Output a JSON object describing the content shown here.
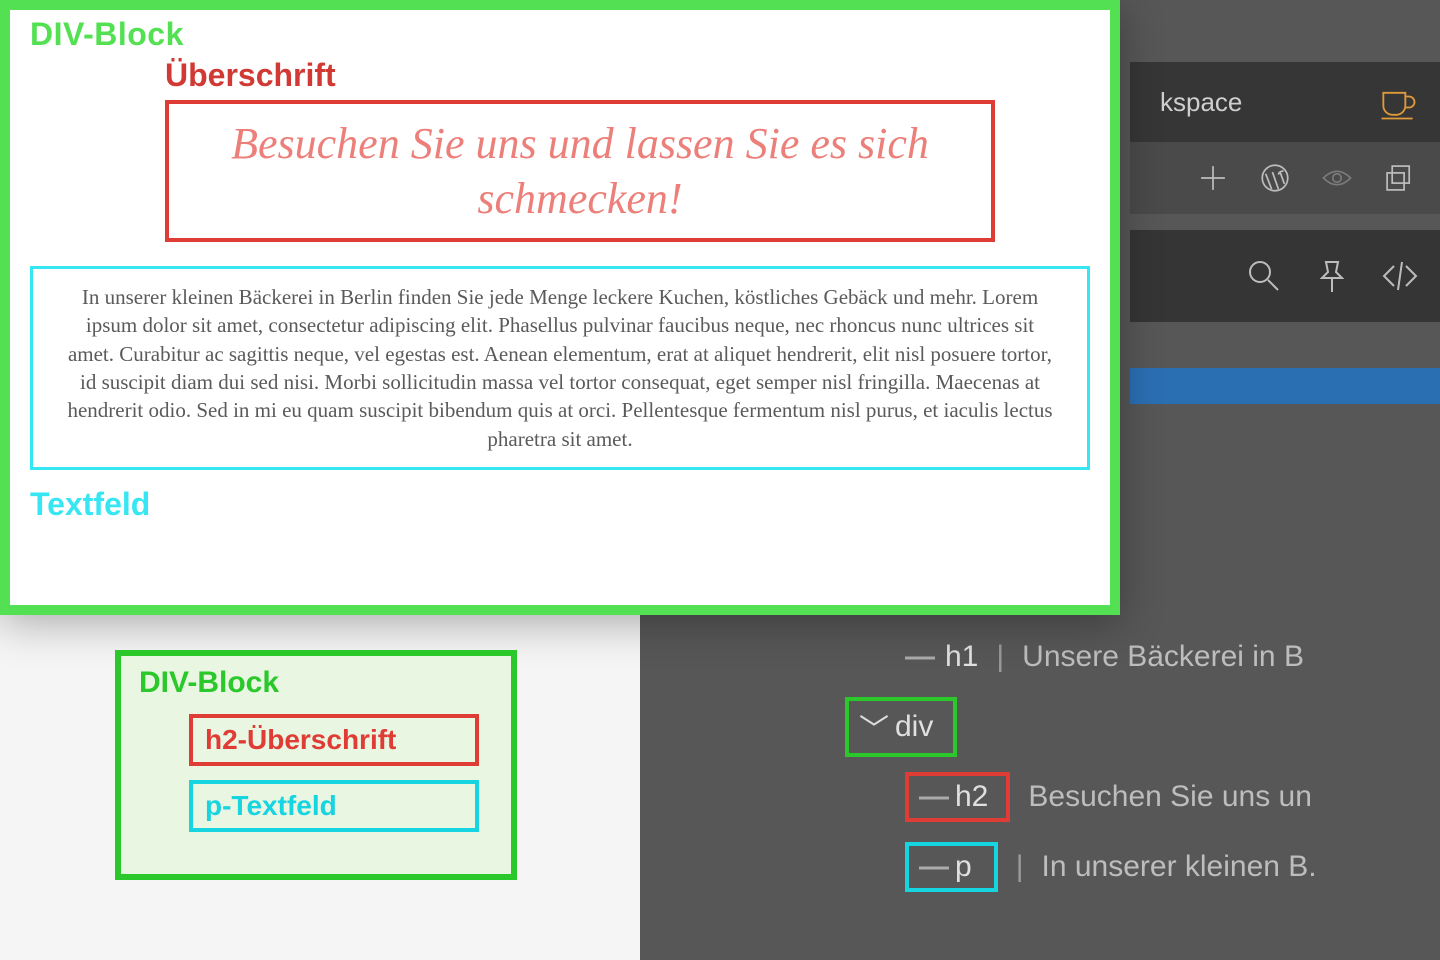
{
  "preview": {
    "label_div": "DIV-Block",
    "label_heading": "Überschrift",
    "h2_text": "Besuchen Sie uns und lassen Sie es sich schmecken!",
    "p_text": "In unserer kleinen Bäckerei in Berlin finden Sie jede Menge leckere Kuchen, köstliches Gebäck und mehr. Lorem ipsum dolor sit amet, consectetur adipiscing elit. Phasellus pulvinar faucibus neque, nec rhoncus nunc ultrices sit amet. Curabitur ac sagittis neque, vel egestas est. Aenean elementum, erat at aliquet hendrerit, elit nisl posuere tortor, id suscipit diam dui sed nisi. Morbi sollicitudin massa vel tortor consequat, eget semper nisl fringilla. Maecenas at hendrerit odio. Sed in mi eu quam suscipit bibendum quis at orci. Pellentesque fermentum nisl purus, et iaculis lectus pharetra sit amet.",
    "label_textfeld": "Textfeld"
  },
  "legend": {
    "div": "DIV-Block",
    "h2": "h2-Überschrift",
    "p": "p-Textfeld"
  },
  "builder": {
    "tab_label": "kspace"
  },
  "tree": {
    "h1_tag": "h1",
    "h1_text": "Unsere Bäckerei in B",
    "div_tag": "div",
    "h2_tag": "h2",
    "h2_text": "Besuchen Sie uns un",
    "p_tag": "p",
    "p_text": "In unserer kleinen B."
  }
}
